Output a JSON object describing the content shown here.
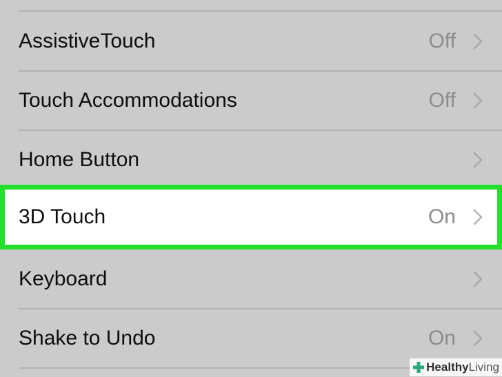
{
  "rows": [
    {
      "label": "AssistiveTouch",
      "value": "Off"
    },
    {
      "label": "Touch Accommodations",
      "value": "Off"
    },
    {
      "label": "Home Button",
      "value": ""
    },
    {
      "label": "3D Touch",
      "value": "On"
    },
    {
      "label": "Keyboard",
      "value": ""
    },
    {
      "label": "Shake to Undo",
      "value": "On"
    }
  ],
  "watermark": {
    "bold": "Healthy",
    "light": " Living"
  },
  "colors": {
    "highlight_border": "#22e02c",
    "background": "#cbcbcb",
    "value_text": "#8c8c8c",
    "watermark_cross": "#2aa67a"
  }
}
